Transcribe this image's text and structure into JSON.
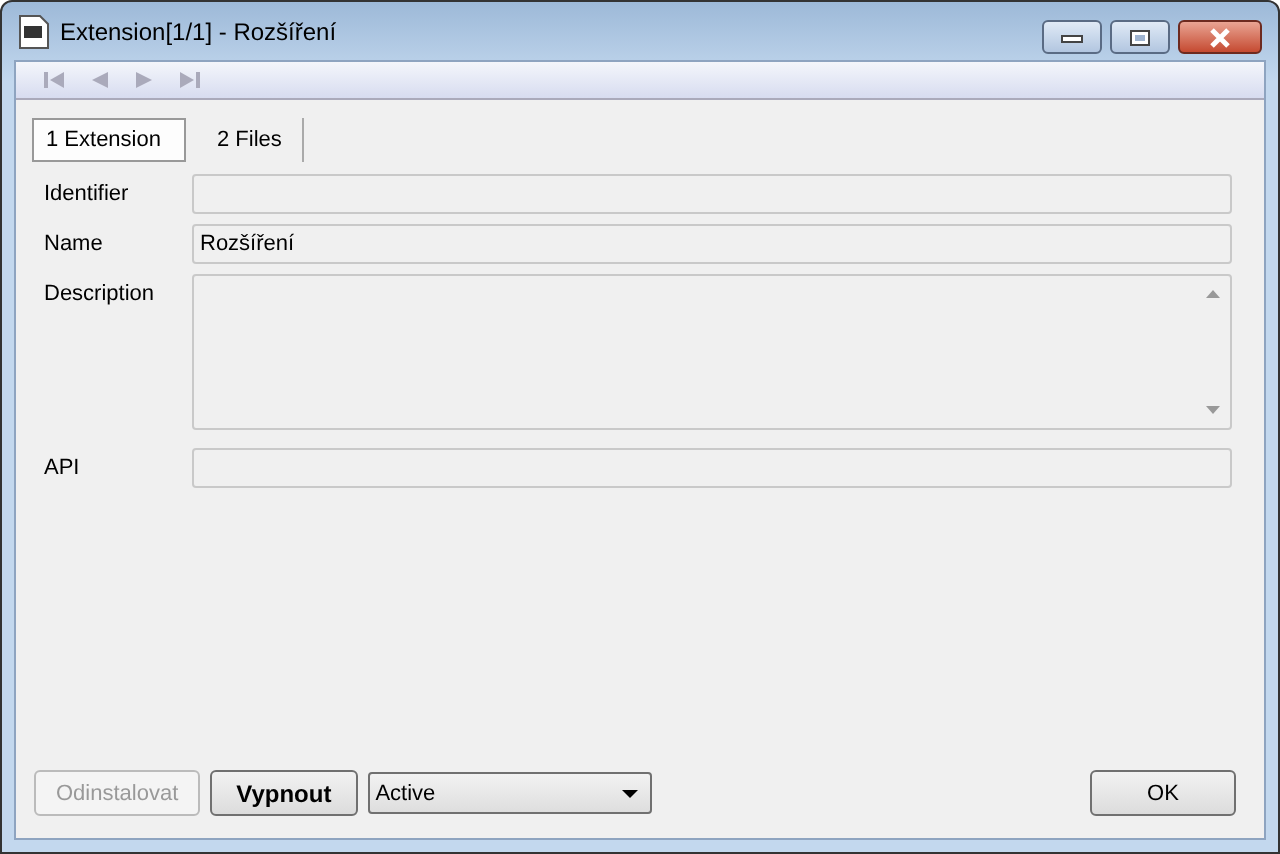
{
  "window": {
    "title": "Extension[1/1] - Rozšíření"
  },
  "tabs": [
    {
      "label": "1 Extension",
      "selected": true
    },
    {
      "label": "2 Files",
      "selected": false
    }
  ],
  "fields": [
    {
      "label": "Identifier",
      "kind": "text"
    },
    {
      "label": "Name",
      "kind": "text",
      "value": "Rozšíření"
    },
    {
      "label": "Description",
      "kind": "textarea"
    },
    {
      "label": "API",
      "kind": "text"
    }
  ],
  "buttons": [
    {
      "label": "Odinstalovat",
      "disabled": true
    },
    {
      "label": "Vypnout",
      "disabled": false
    }
  ],
  "status_select": {
    "value": "Active"
  },
  "ok_button": {
    "label": "OK"
  }
}
